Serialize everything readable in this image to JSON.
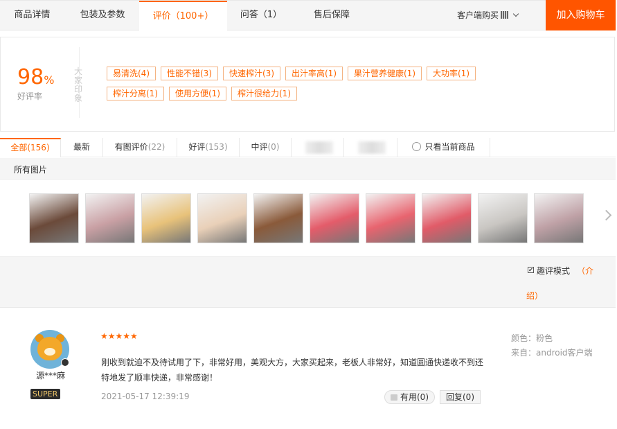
{
  "topbar": {
    "tabs": [
      {
        "label": "商品详情"
      },
      {
        "label": "包装及参数"
      },
      {
        "label": "评价（100+）"
      },
      {
        "label": "问答（1）"
      },
      {
        "label": "售后保障"
      }
    ],
    "client_buy": "客户端购买",
    "add_to_cart": "加入购物车"
  },
  "rating": {
    "score": "98",
    "percent_sign": "%",
    "score_label": "好评率",
    "impression_label": "大家印象",
    "tags": [
      "易清洗(4)",
      "性能不错(3)",
      "快速榨汁(3)",
      "出汁率高(1)",
      "果汁营养健康(1)",
      "大功率(1)",
      "榨汁分离(1)",
      "使用方便(1)",
      "榨汁很给力(1)"
    ]
  },
  "filters": {
    "all": {
      "label": "全部",
      "count": "(156)"
    },
    "latest": {
      "label": "最新"
    },
    "with_pics": {
      "label": "有图评价",
      "count": "(22)"
    },
    "good": {
      "label": "好评",
      "count": "(153)"
    },
    "medium": {
      "label": "中评",
      "count": "(0)"
    },
    "current_only": "只看当前商品"
  },
  "all_pics_label": "所有图片",
  "thumb_colors": [
    "#6b4a3a",
    "#c9a0a4",
    "#e8c27a",
    "#e9d0b8",
    "#8a5a3a",
    "#e45c6a",
    "#e8646f",
    "#e15b68",
    "#c9c6c2",
    "#bfa1a6"
  ],
  "fun_mode": {
    "label": "趣评模式",
    "intro_a": "（介",
    "intro_b": "绍）"
  },
  "review": {
    "username": "源***麻",
    "badge": "SUPER",
    "stars": "★★★★★",
    "text": "刚收到就迫不及待试用了下，非常好用，美观大方，大家买起来，老板人非常好，知道圆通快递收不到还特地发了顺丰快递，非常感谢！",
    "date": "2021-05-17 12:39:19",
    "useful": "有用(0)",
    "reply": "回复(0)",
    "color": "颜色：粉色",
    "source": "来自：android客户端"
  }
}
